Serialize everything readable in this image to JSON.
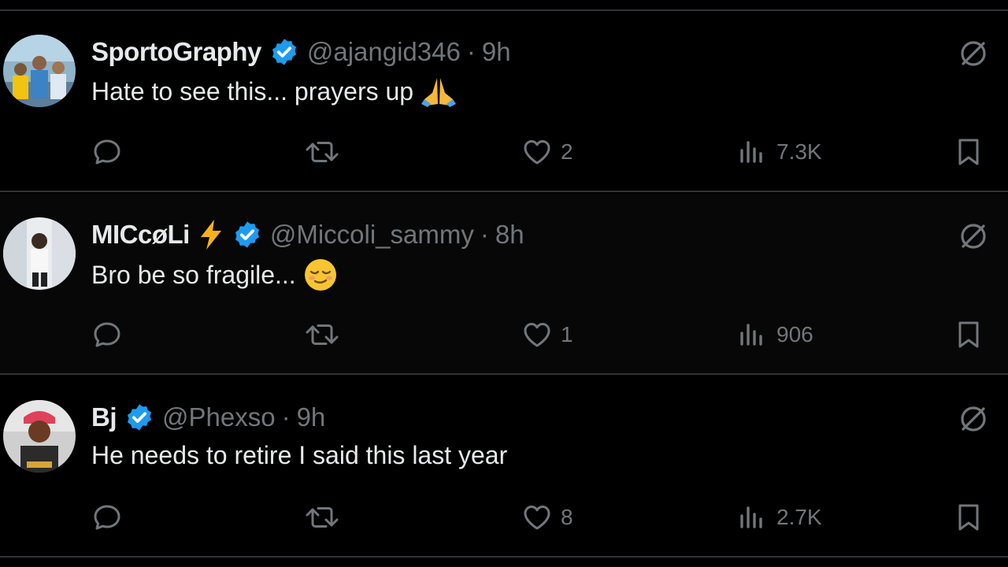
{
  "colors": {
    "background": "#000000",
    "text": "#e7e9ea",
    "muted": "#71767b",
    "divider": "#2f3336",
    "verified": "#1d9bf0"
  },
  "replies": [
    {
      "name": "SportoGraphy",
      "handle": "@ajangid346",
      "separator": "·",
      "time": "9h",
      "text": "Hate to see this... prayers up",
      "emoji_icon": "folded-hands-icon",
      "likes": "2",
      "views": "7.3K"
    },
    {
      "name": "MICcøLi",
      "name_icon": "lightning-bolt-icon",
      "handle": "@Miccoli_sammy",
      "separator": "·",
      "time": "8h",
      "text": "Bro be so fragile...",
      "emoji_icon": "relieved-face-icon",
      "likes": "1",
      "views": "906"
    },
    {
      "name": "Bj",
      "handle": "@Phexso",
      "separator": "·",
      "time": "9h",
      "text": "He needs to retire I said this last year",
      "likes": "8",
      "views": "2.7K"
    }
  ]
}
